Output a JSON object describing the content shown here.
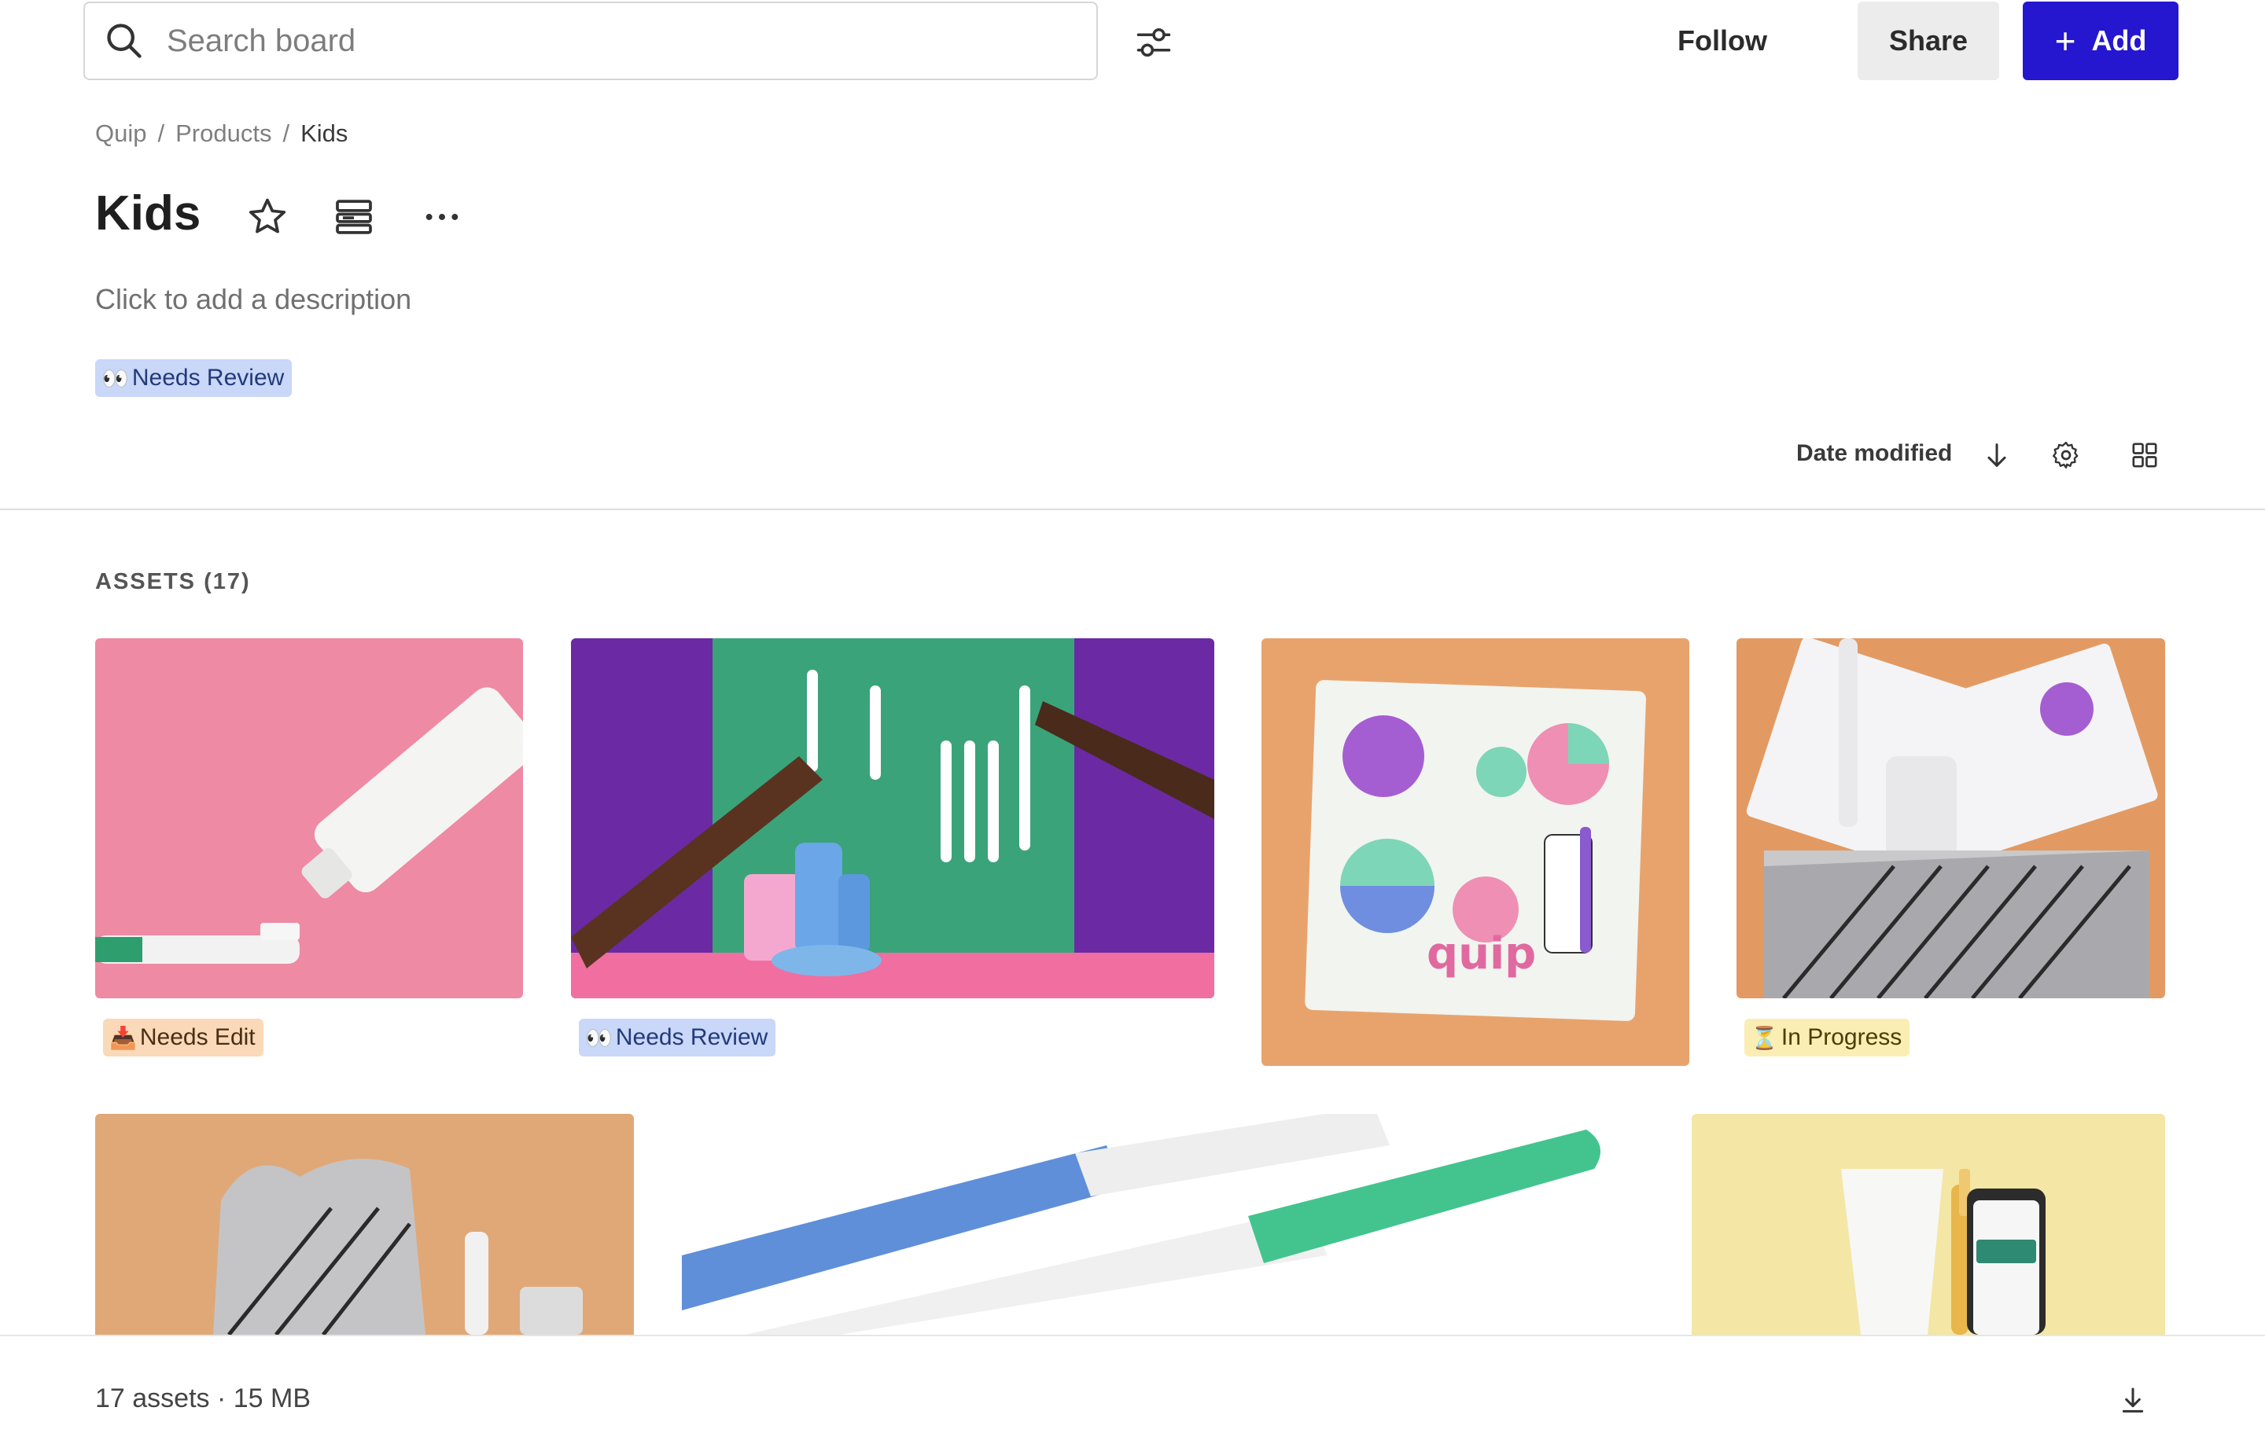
{
  "header": {
    "search_placeholder": "Search board",
    "follow_label": "Follow",
    "share_label": "Share",
    "add_label": "Add",
    "accent_color": "#2516d0"
  },
  "breadcrumb": {
    "items": [
      "Quip",
      "Products",
      "Kids"
    ],
    "separator": "/"
  },
  "board": {
    "title": "Kids",
    "description_placeholder": "Click to add a description",
    "tag": {
      "emoji": "👀",
      "label": "Needs Review"
    }
  },
  "sort": {
    "label": "Date modified",
    "direction_icon": "arrow-down-icon"
  },
  "assets": {
    "heading": "ASSETS (17)",
    "items": [
      {
        "name": "pink-toothpaste",
        "tag": {
          "emoji": "📥",
          "label": "Needs Edit"
        }
      },
      {
        "name": "purple-green-hands",
        "tag": {
          "emoji": "👀",
          "label": "Needs Review"
        }
      },
      {
        "name": "quip-sticker-sheet",
        "tag": null
      },
      {
        "name": "packaging-brush",
        "tag": {
          "emoji": "⏳",
          "label": "In Progress"
        }
      },
      {
        "name": "foil-pack",
        "tag": null
      },
      {
        "name": "blue-green-toothbrushes",
        "tag": null
      },
      {
        "name": "yellow-app",
        "tag": null
      }
    ]
  },
  "footer": {
    "summary": "17 assets · 15 MB"
  }
}
